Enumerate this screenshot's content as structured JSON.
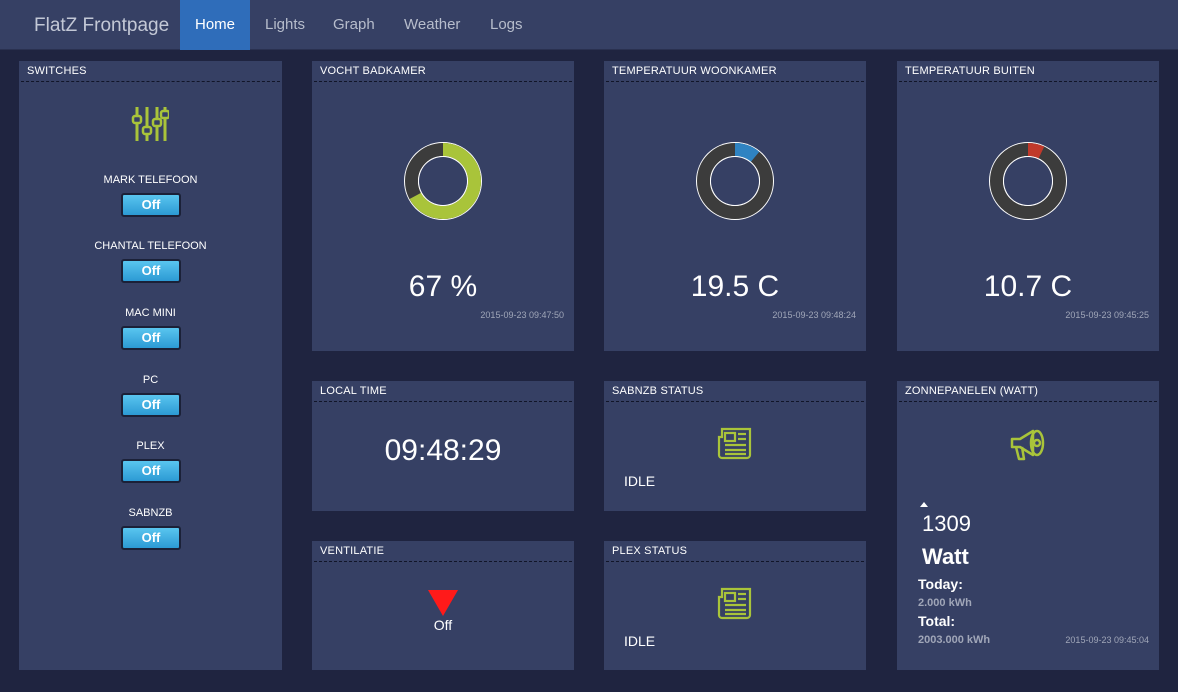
{
  "nav": {
    "brand": "FlatZ Frontpage",
    "items": [
      "Home",
      "Lights",
      "Graph",
      "Weather",
      "Logs"
    ]
  },
  "switches": {
    "title": "SWITCHES",
    "icon": "sliders-icon",
    "items": [
      {
        "label": "MARK TELEFOON",
        "state": "Off"
      },
      {
        "label": "CHANTAL TELEFOON",
        "state": "Off"
      },
      {
        "label": "MAC MINI",
        "state": "Off"
      },
      {
        "label": "PC",
        "state": "Off"
      },
      {
        "label": "PLEX",
        "state": "Off"
      },
      {
        "label": "SABNZB",
        "state": "Off"
      }
    ]
  },
  "humidity": {
    "title": "VOCHT BADKAMER",
    "value": "67 %",
    "fraction": 0.67,
    "color": "#a9c43a",
    "timestamp": "2015-09-23 09:47:50"
  },
  "temp_living": {
    "title": "TEMPERATUUR WOONKAMER",
    "value": "19.5 C",
    "fraction": 0.11,
    "color": "#2f83c2",
    "timestamp": "2015-09-23 09:48:24"
  },
  "temp_outside": {
    "title": "TEMPERATUUR BUITEN",
    "value": "10.7 C",
    "fraction": 0.07,
    "color": "#c0392b",
    "timestamp": "2015-09-23 09:45:25"
  },
  "local_time": {
    "title": "LOCAL TIME",
    "value": "09:48:29"
  },
  "sabnzb": {
    "title": "SABNZB STATUS",
    "status": "IDLE",
    "icon": "newspaper-icon"
  },
  "ventilation": {
    "title": "VENTILATIE",
    "state": "Off",
    "icon": "arrow-down-icon",
    "icon_color": "#ff1a1a"
  },
  "plex": {
    "title": "PLEX STATUS",
    "status": "IDLE",
    "icon": "newspaper-icon"
  },
  "solar": {
    "title": "ZONNEPANELEN (WATT)",
    "icon": "megaphone-icon",
    "value": "1309",
    "unit": "Watt",
    "today_label": "Today:",
    "today_value": "2.000 kWh",
    "total_label": "Total:",
    "total_value": "2003.000 kWh",
    "timestamp": "2015-09-23 09:45:04"
  },
  "colors": {
    "background": "#1f2440",
    "panel": "#364064",
    "accent": "#a9c43a",
    "active_nav": "#2f6dba"
  }
}
